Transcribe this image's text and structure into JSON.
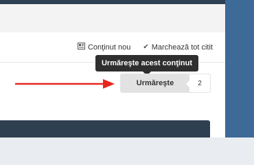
{
  "toolbar": {
    "unread_label": "Conţinut nou",
    "mark_read_label": "Marchează tot citit"
  },
  "follow": {
    "tooltip": "Urmăreşte acest conţinut",
    "button_label": "Urmăreşte",
    "count": "2"
  },
  "colors": {
    "side_strip": "#3d6a96",
    "header_dark": "#2e3f52",
    "arrow": "#e8261f"
  }
}
